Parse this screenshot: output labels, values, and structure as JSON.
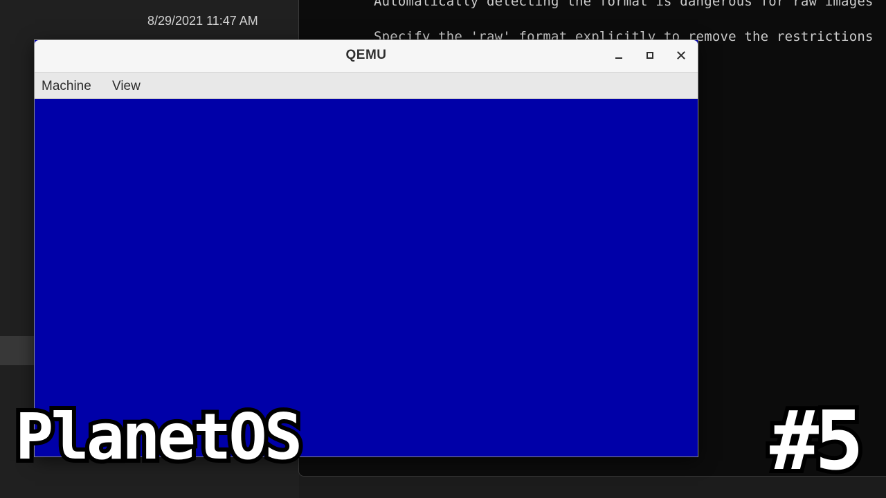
{
  "background_explorer": {
    "date_modified": "8/29/2021 11:47 AM"
  },
  "terminal": {
    "lines": [
      "Automatically detecting the format is dangerous for raw images",
      "Specify the 'raw' format explicitly to remove the restrictions"
    ]
  },
  "qemu_window": {
    "title": "QEMU",
    "menu": [
      "Machine",
      "View"
    ],
    "controls": {
      "minimize_icon": "minimize-icon",
      "maximize_icon": "maximize-icon",
      "close_icon": "close-icon"
    },
    "screen_color": "#0000a8"
  },
  "overlay": {
    "title": "PlanetOS",
    "episode": "#5"
  }
}
